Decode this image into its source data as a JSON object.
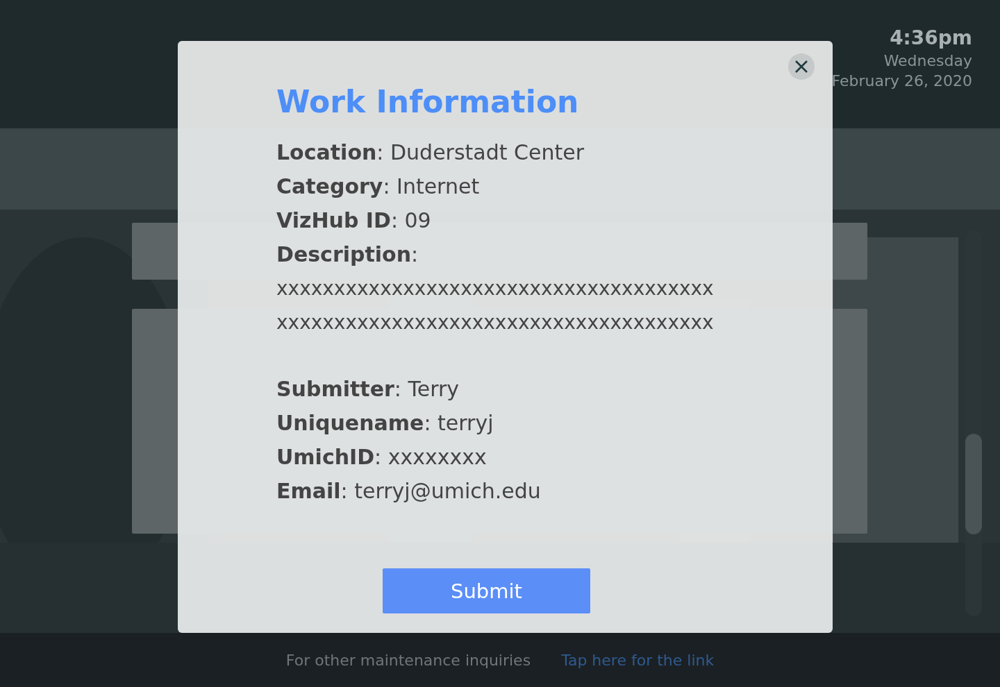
{
  "clock": {
    "time": "4:36pm",
    "weekday": "Wednesday",
    "date": "February 26, 2020"
  },
  "footer": {
    "text": "For other maintenance inquiries",
    "link": "Tap here for the link"
  },
  "modal": {
    "title": "Work Information",
    "fields": [
      "**Location**: Duderstadt Center",
      "**Category**: Internet",
      "**VizHub ID**: 09"
    ],
    "description": {
      "label": "**Description**:",
      "lines": [
        "xxxxxxxxxxxxxxxxxxxxxxxxxxxxxxxxxxxxxx",
        "xxxxxxxxxxxxxxxxxxxxxxxxxxxxxxxxxxxxxx"
      ]
    },
    "submitter_fields": [
      "**Submitter**: Terry",
      "**Uniquename**: terryj",
      "**UmichID**: xxxxxxxx",
      "**Email**: terryj@umich.edu"
    ],
    "button": "Submit"
  }
}
